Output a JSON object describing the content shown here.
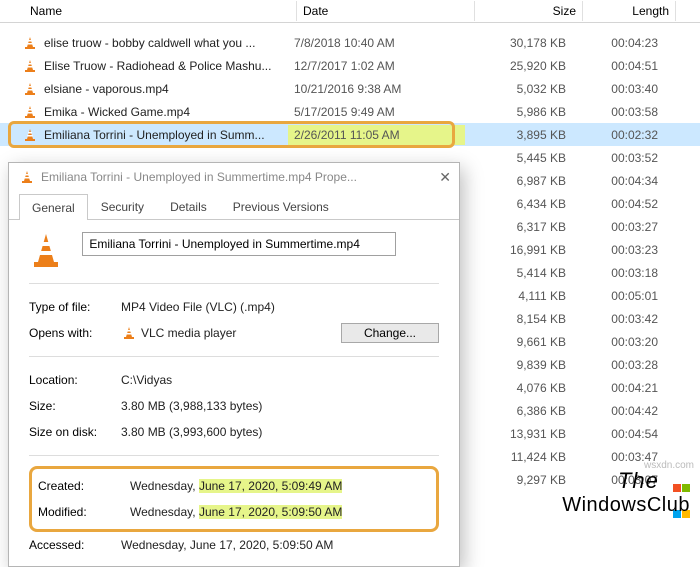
{
  "columns": {
    "name": "Name",
    "date": "Date",
    "size": "Size",
    "length": "Length"
  },
  "rows": [
    {
      "name": "elise truow - bobby caldwell what you ...",
      "date": "7/8/2018 10:40 AM",
      "size": "30,178 KB",
      "length": "00:04:23"
    },
    {
      "name": "Elise Truow - Radiohead & Police Mashu...",
      "date": "12/7/2017 1:02 AM",
      "size": "25,920 KB",
      "length": "00:04:51"
    },
    {
      "name": "elsiane - vaporous.mp4",
      "date": "10/21/2016 9:38 AM",
      "size": "5,032 KB",
      "length": "00:03:40"
    },
    {
      "name": "Emika - Wicked Game.mp4",
      "date": "5/17/2015 9:49 AM",
      "size": "5,986 KB",
      "length": "00:03:58"
    },
    {
      "name": "Emiliana Torrini - Unemployed in Summ...",
      "date": "2/26/2011 11:05 AM",
      "size": "3,895 KB",
      "length": "00:02:32"
    }
  ],
  "more_rows": [
    {
      "size": "5,445 KB",
      "length": "00:03:52"
    },
    {
      "size": "6,987 KB",
      "length": "00:04:34"
    },
    {
      "size": "6,434 KB",
      "length": "00:04:52"
    },
    {
      "size": "6,317 KB",
      "length": "00:03:27"
    },
    {
      "size": "16,991 KB",
      "length": "00:03:23"
    },
    {
      "size": "5,414 KB",
      "length": "00:03:18"
    },
    {
      "size": "4,111 KB",
      "length": "00:05:01"
    },
    {
      "size": "8,154 KB",
      "length": "00:03:42"
    },
    {
      "size": "9,661 KB",
      "length": "00:03:20"
    },
    {
      "size": "9,839 KB",
      "length": "00:03:28"
    },
    {
      "size": "4,076 KB",
      "length": "00:04:21"
    },
    {
      "size": "6,386 KB",
      "length": "00:04:42"
    },
    {
      "size": "13,931 KB",
      "length": "00:04:54"
    },
    {
      "size": "11,424 KB",
      "length": "00:03:47"
    },
    {
      "size": "9,297 KB",
      "length": "00:03:07"
    }
  ],
  "dialog": {
    "title": "Emiliana Torrini - Unemployed in Summertime.mp4 Prope...",
    "tabs": [
      "General",
      "Security",
      "Details",
      "Previous Versions"
    ],
    "filename": "Emiliana Torrini - Unemployed in Summertime.mp4",
    "type_label": "Type of file:",
    "type_value": "MP4 Video File (VLC) (.mp4)",
    "opens_label": "Opens with:",
    "opens_value": "VLC media player",
    "change_label": "Change...",
    "location_label": "Location:",
    "location_value": "C:\\Vidyas",
    "size_label": "Size:",
    "size_value": "3.80 MB (3,988,133 bytes)",
    "sizeondisk_label": "Size on disk:",
    "sizeondisk_value": "3.80 MB (3,993,600 bytes)",
    "created_label": "Created:",
    "created_prefix": "Wednesday, ",
    "created_value": "June 17, 2020, 5:09:49 AM",
    "modified_label": "Modified:",
    "modified_prefix": "Wednesday, ",
    "modified_value": "June 17, 2020, 5:09:50 AM",
    "accessed_label": "Accessed:",
    "accessed_value": "Wednesday, June 17, 2020, 5:09:50 AM"
  },
  "watermark": {
    "line1": "The",
    "line2": "WindowsClub",
    "url": "wsxdn.com"
  },
  "icons": {
    "vlc": "vlc-cone-icon",
    "close": "close-icon",
    "win": "windows-logo-icon"
  }
}
